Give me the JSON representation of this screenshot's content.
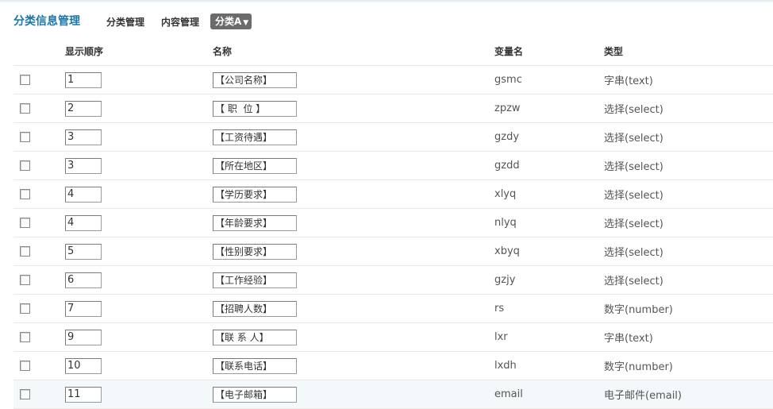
{
  "header": {
    "title": "分类信息管理",
    "nav": [
      "分类管理",
      "内容管理"
    ],
    "category_dropdown": "分类A"
  },
  "table": {
    "columns": [
      "显示顺序",
      "名称",
      "变量名",
      "类型"
    ],
    "rows": [
      {
        "order": "1",
        "name": "【公司名称】",
        "var": "gsmc",
        "type": "字串(text)"
      },
      {
        "order": "2",
        "name": "【 职  位 】",
        "var": "zpzw",
        "type": "选择(select)"
      },
      {
        "order": "3",
        "name": "【工资待遇】",
        "var": "gzdy",
        "type": "选择(select)"
      },
      {
        "order": "3",
        "name": "【所在地区】",
        "var": "gzdd",
        "type": "选择(select)"
      },
      {
        "order": "4",
        "name": "【学历要求】",
        "var": "xlyq",
        "type": "选择(select)"
      },
      {
        "order": "4",
        "name": "【年龄要求】",
        "var": "nlyq",
        "type": "选择(select)"
      },
      {
        "order": "5",
        "name": "【性别要求】",
        "var": "xbyq",
        "type": "选择(select)"
      },
      {
        "order": "6",
        "name": "【工作经验】",
        "var": "gzjy",
        "type": "选择(select)"
      },
      {
        "order": "7",
        "name": "【招聘人数】",
        "var": "rs",
        "type": "数字(number)"
      },
      {
        "order": "9",
        "name": "【联 系 人】",
        "var": "lxr",
        "type": "字串(text)"
      },
      {
        "order": "10",
        "name": "【联系电话】",
        "var": "lxdh",
        "type": "数字(number)"
      },
      {
        "order": "11",
        "name": "【电子邮箱】",
        "var": "email",
        "type": "电子邮件(email)"
      }
    ]
  }
}
